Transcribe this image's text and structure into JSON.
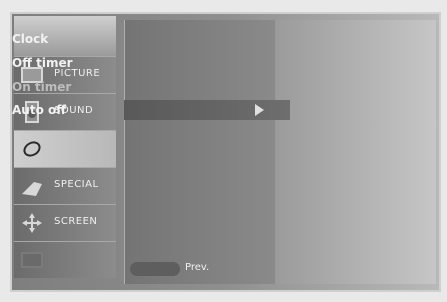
{
  "sidebar": {
    "items": [
      {
        "label": "PICTURE",
        "icon": "picture-icon",
        "active": false
      },
      {
        "label": "SOUND",
        "icon": "speaker-icon",
        "active": false
      },
      {
        "label": "",
        "icon": "clock-icon",
        "active": true
      },
      {
        "label": "SPECIAL",
        "icon": "special-icon",
        "active": false
      },
      {
        "label": "SCREEN",
        "icon": "move-icon",
        "active": false
      },
      {
        "label": "",
        "icon": "pip-icon",
        "active": false
      }
    ]
  },
  "menu": {
    "items": [
      {
        "label": "Clock",
        "enabled": true
      },
      {
        "label": "Off timer",
        "enabled": true
      },
      {
        "label": "On timer",
        "enabled": false
      },
      {
        "label": "Auto off",
        "enabled": true,
        "selected": true
      }
    ]
  },
  "footer": {
    "prev_label": "Prev."
  }
}
